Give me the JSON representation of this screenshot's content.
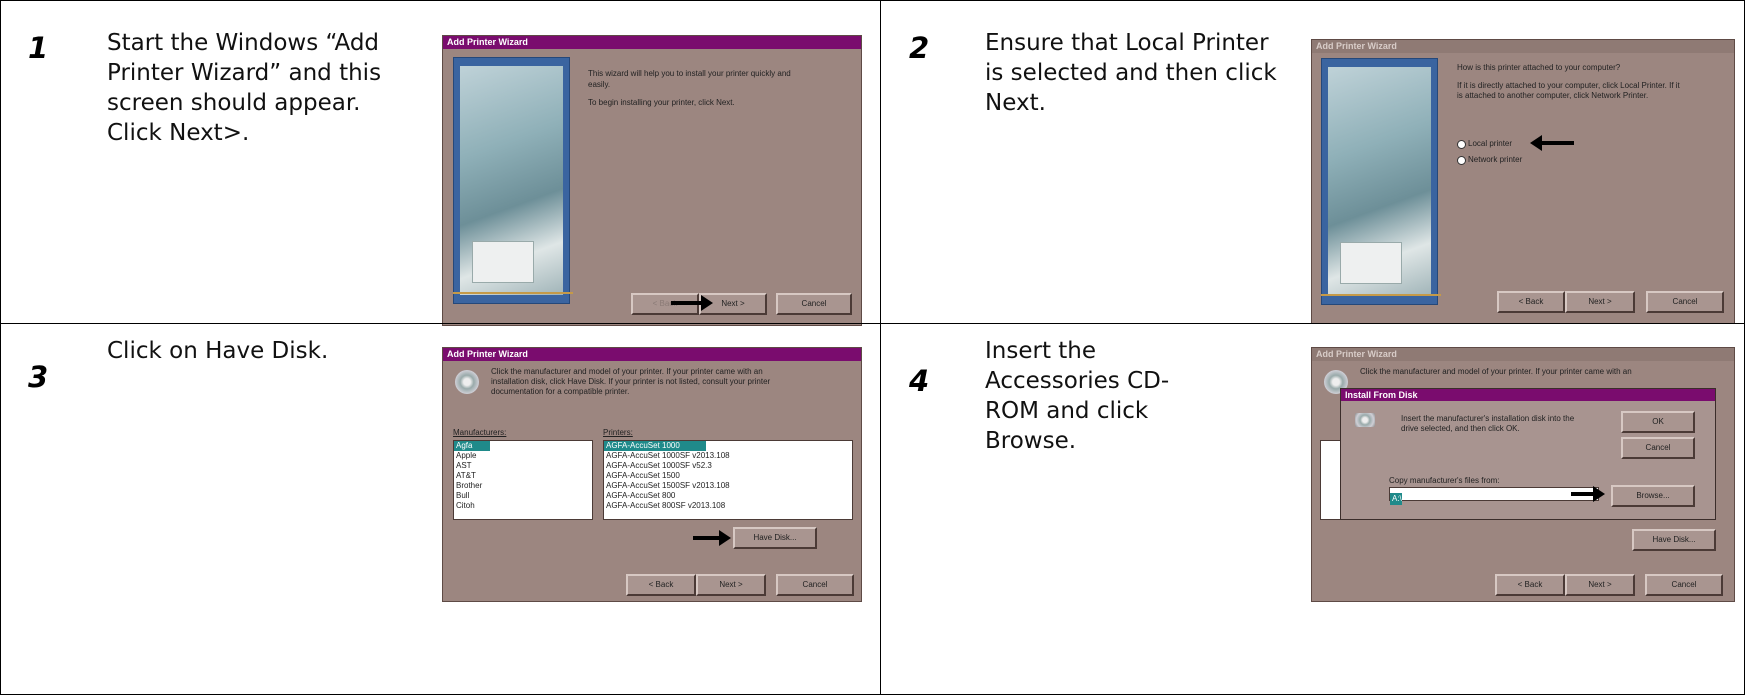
{
  "steps": [
    {
      "number": "1",
      "text": "Start the Windows “Add Printer Wizard” and this screen should appear. Click Next>."
    },
    {
      "number": "2",
      "text": "Ensure that Local Printer is selected and then click Next."
    },
    {
      "number": "3",
      "text": "Click on Have Disk."
    },
    {
      "number": "4",
      "text": "Insert the Accessories CD-ROM and click Browse."
    }
  ],
  "dialogs": {
    "d1": {
      "title": "Add Printer Wizard",
      "line1": "This wizard will help you to install your printer quickly and",
      "line2": "easily.",
      "line3": "To begin installing your printer, click Next.",
      "back": "< Back",
      "next": "Next >",
      "cancel": "Cancel"
    },
    "d2": {
      "title": "Add Printer Wizard",
      "line1": "How is this printer attached to your computer?",
      "line2": "If it is directly attached to your computer, click Local Printer. If it",
      "line3": "is attached to another computer, click Network Printer.",
      "opt_local": "Local printer",
      "opt_network": "Network printer",
      "back": "< Back",
      "next": "Next >",
      "cancel": "Cancel"
    },
    "d3": {
      "title": "Add Printer Wizard",
      "line1": "Click the manufacturer and model of your printer. If your printer came with an",
      "line2": "installation disk, click Have Disk. If your printer is not listed, consult your printer",
      "line3": "documentation for a compatible printer.",
      "manufacturers_label": "Manufacturers:",
      "printers_label": "Printers:",
      "manufacturers": [
        "Agfa",
        "Apple",
        "AST",
        "AT&T",
        "Brother",
        "Bull",
        "Citoh"
      ],
      "printers": [
        "AGFA-AccuSet 1000",
        "AGFA-AccuSet 1000SF v2013.108",
        "AGFA-AccuSet 1000SF v52.3",
        "AGFA-AccuSet 1500",
        "AGFA-AccuSet 1500SF v2013.108",
        "AGFA-AccuSet 800",
        "AGFA-AccuSet 800SF v2013.108"
      ],
      "have_disk": "Have Disk...",
      "back": "< Back",
      "next": "Next >",
      "cancel": "Cancel"
    },
    "d4": {
      "title": "Add Printer Wizard",
      "line1": "Click the manufacturer and model of your printer. If your printer came with an",
      "sub_title": "Install From Disk",
      "sub_line1": "Insert the manufacturer's installation disk into the",
      "sub_line2": "drive selected, and then click OK.",
      "ok": "OK",
      "cancel_small": "Cancel",
      "copy_label": "Copy manufacturer's files from:",
      "copy_value": "A:\\",
      "browse": "Browse...",
      "have_disk": "Have Disk...",
      "back": "< Back",
      "next": "Next >",
      "cancel": "Cancel"
    }
  }
}
